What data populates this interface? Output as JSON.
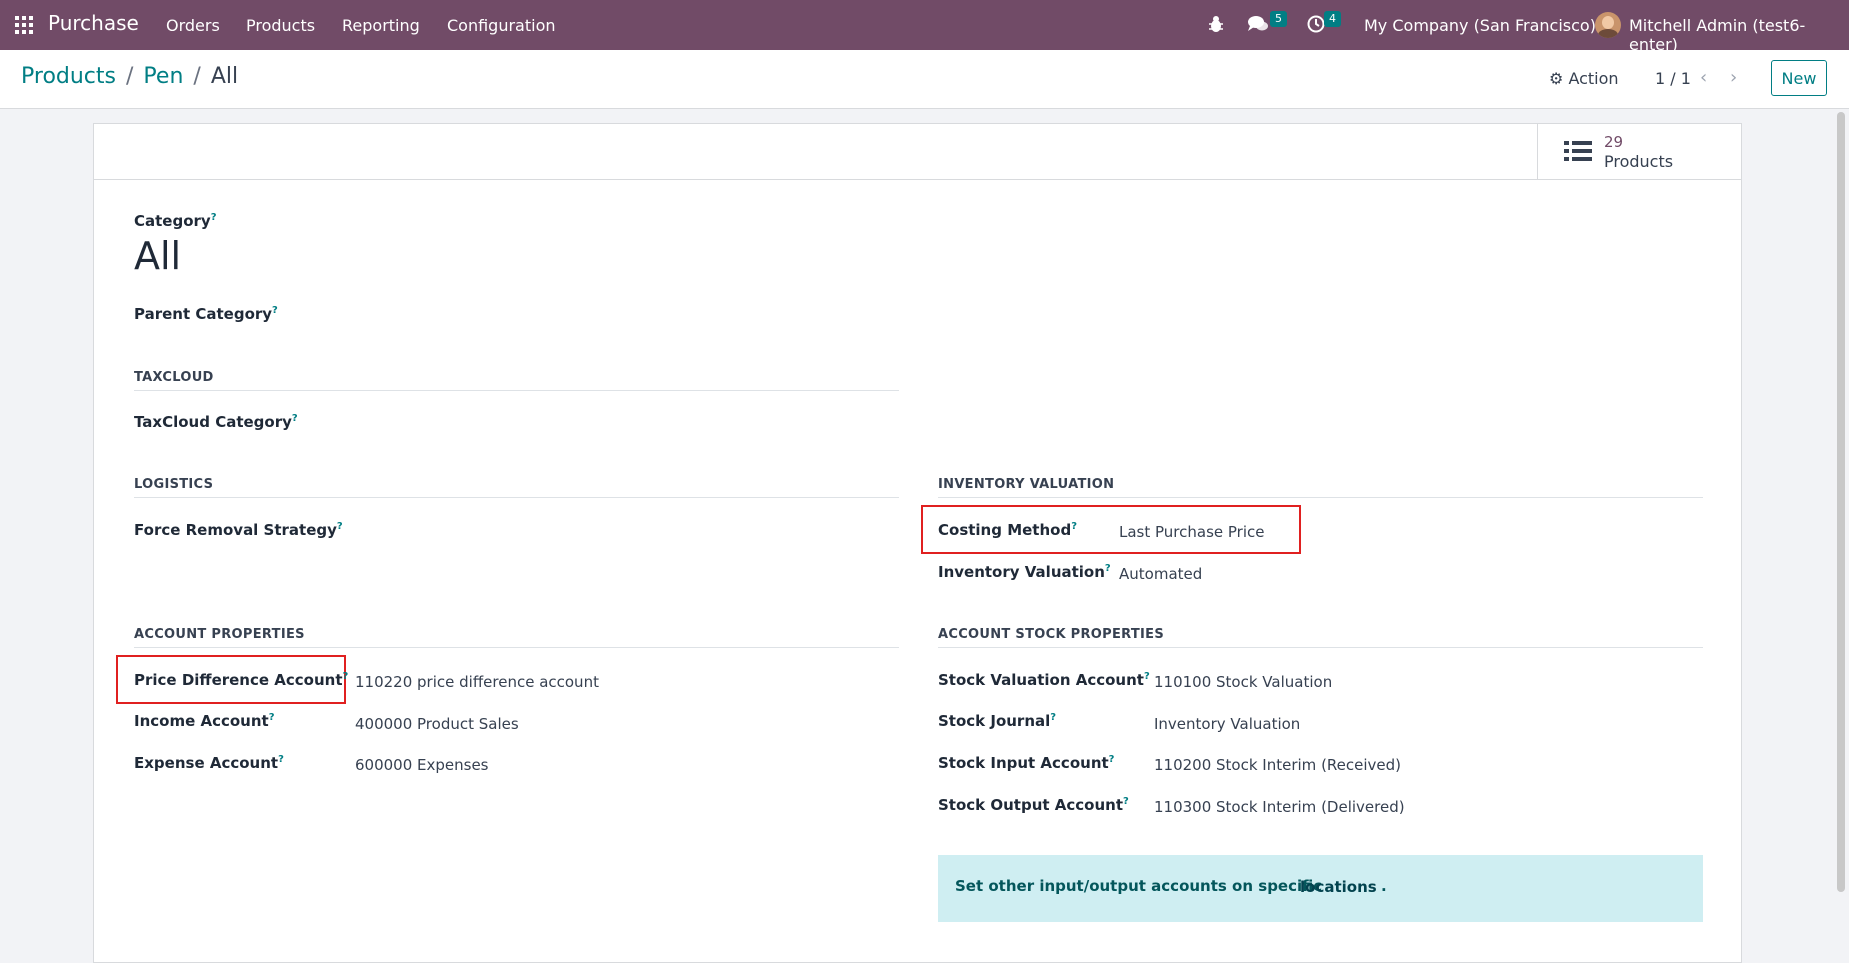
{
  "navbar": {
    "brand": "Purchase",
    "menu": [
      "Orders",
      "Products",
      "Reporting",
      "Configuration"
    ],
    "messages_badge": "5",
    "activities_badge": "4",
    "company": "My Company (San Francisco)",
    "user": "Mitchell Admin (test6-enter)"
  },
  "control_panel": {
    "breadcrumb": [
      "Products",
      "Pen",
      "All"
    ],
    "action_label": "Action",
    "pager": "1 / 1",
    "new_label": "New"
  },
  "smart_button": {
    "count": "29",
    "label": "Products"
  },
  "form": {
    "category_label": "Category",
    "name": "All",
    "parent_category_label": "Parent Category",
    "taxcloud_section": "TAXCLOUD",
    "taxcloud_category_label": "TaxCloud Category",
    "logistics_section": "LOGISTICS",
    "force_removal_label": "Force Removal Strategy",
    "inventory_valuation_section": "INVENTORY VALUATION",
    "costing_method_label": "Costing Method",
    "costing_method_value": "Last Purchase Price",
    "inventory_valuation_label": "Inventory Valuation",
    "inventory_valuation_value": "Automated",
    "account_properties_section": "ACCOUNT PROPERTIES",
    "price_diff_label": "Price Difference Account",
    "price_diff_value": "110220 price difference account",
    "income_label": "Income Account",
    "income_value": "400000 Product Sales",
    "expense_label": "Expense Account",
    "expense_value": "600000 Expenses",
    "account_stock_section": "ACCOUNT STOCK PROPERTIES",
    "stock_valuation_label": "Stock Valuation Account",
    "stock_valuation_value": "110100 Stock Valuation",
    "stock_journal_label": "Stock Journal",
    "stock_journal_value": "Inventory Valuation",
    "stock_input_label": "Stock Input Account",
    "stock_input_value": "110200 Stock Interim (Received)",
    "stock_output_label": "Stock Output Account",
    "stock_output_value": "110300 Stock Interim (Delivered)",
    "alert_text": "Set other input/output accounts on specific",
    "alert_link": "locations",
    "alert_dot": ".",
    "help_mark": "?"
  }
}
